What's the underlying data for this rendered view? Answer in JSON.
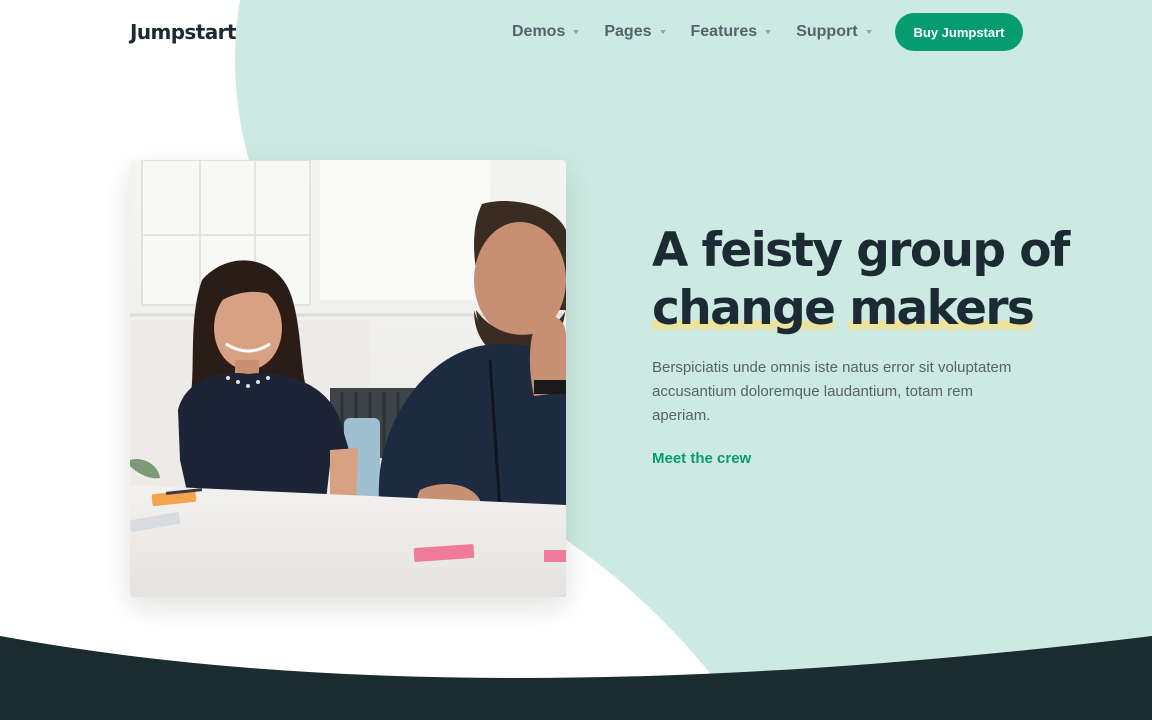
{
  "brand": {
    "logo_text": "Jumpstart"
  },
  "nav": {
    "items": [
      {
        "label": "Demos"
      },
      {
        "label": "Pages"
      },
      {
        "label": "Features"
      },
      {
        "label": "Support"
      }
    ],
    "cta_label": "Buy Jumpstart"
  },
  "hero": {
    "headline_part1": "A feisty group of ",
    "headline_highlight1": "change",
    "headline_space": " ",
    "headline_highlight2": "makers",
    "description": "Berspiciatis unde omnis iste natus error sit voluptatem accusantium doloremque laudantium, totam rem aperiam.",
    "cta_label": "Meet the crew",
    "image_name": "team-meeting-photo"
  },
  "colors": {
    "accent": "#079c6f",
    "mint_background": "#cceae1",
    "dark_footer": "#1b2b30",
    "highlight": "#ebe3a1",
    "heading": "#1c2b33",
    "body_text": "#55636b"
  },
  "icons": {
    "nav_caret": "caret-down-icon"
  }
}
